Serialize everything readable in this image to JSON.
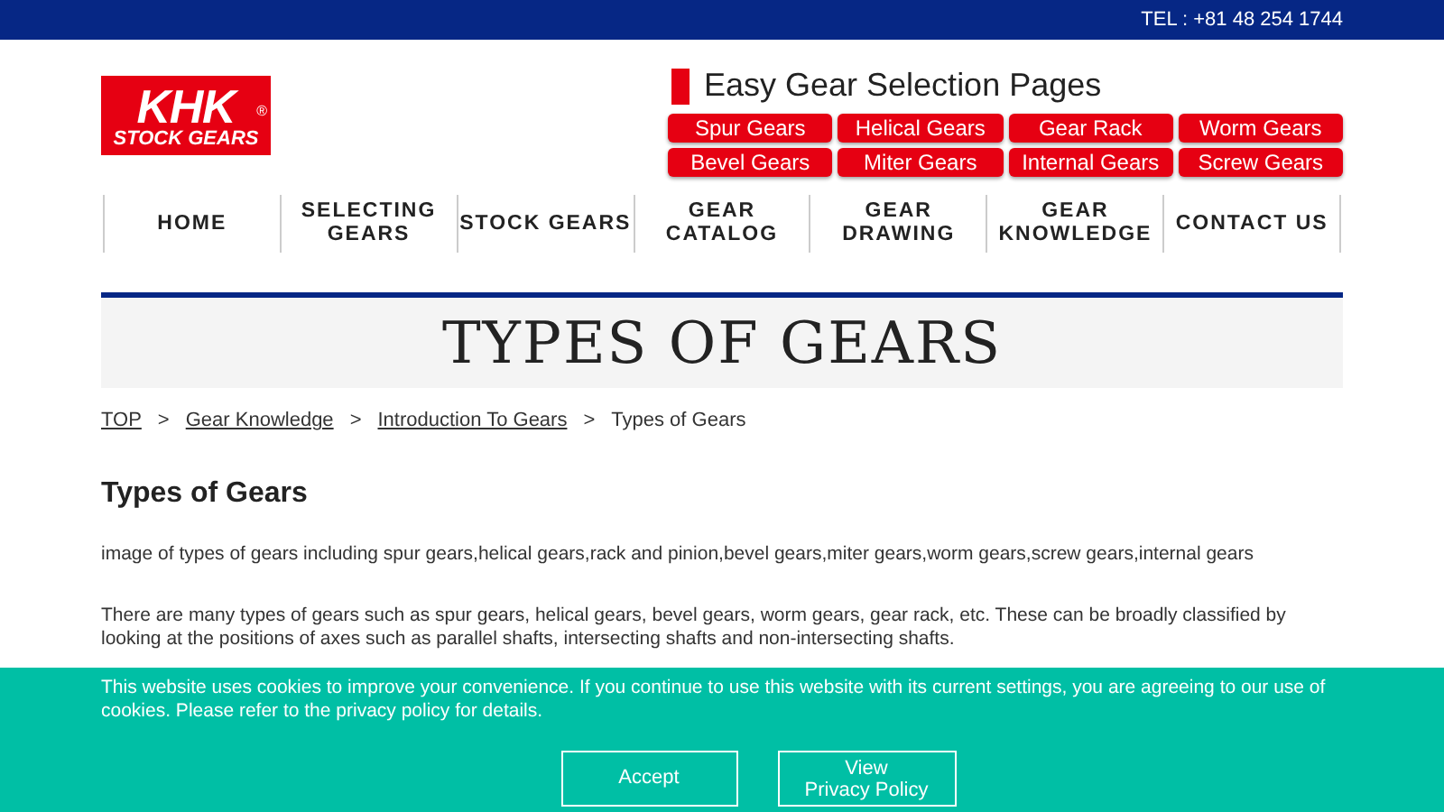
{
  "top_bar": {
    "phone": "TEL : +81 48 254 1744"
  },
  "logo": {
    "line_1": "KHK",
    "line_2": "STOCK GEARS",
    "mark": "®"
  },
  "gear_selection": {
    "title": "Easy Gear Selection Pages",
    "buttons": [
      "Spur Gears",
      "Helical Gears",
      "Gear Rack",
      "Worm Gears",
      "Bevel Gears",
      "Miter Gears",
      "Internal Gears",
      "Screw Gears"
    ]
  },
  "nav": [
    "HOME",
    "SELECTING GEARS",
    "STOCK GEARS",
    "GEAR CATALOG",
    "GEAR DRAWING",
    "GEAR KNOWLEDGE",
    "CONTACT US"
  ],
  "page_title": "TYPES OF GEARS",
  "breadcrumb": {
    "links": [
      "TOP",
      "Gear Knowledge",
      "Introduction To Gears"
    ],
    "separator": ">",
    "current": "Types of Gears"
  },
  "content": {
    "heading": "Types of Gears",
    "image_alt": "image of types of gears including spur gears,helical gears,rack and pinion,bevel gears,miter gears,worm gears,screw gears,internal gears",
    "paragraphs": [
      "There are many types of gears such as spur gears, helical gears, bevel gears, worm gears, gear rack, etc. These can be broadly classified by looking at the positions of axes such as parallel shafts, intersecting shafts and non-intersecting shafts."
    ]
  },
  "cookie_banner": {
    "message": "This website uses cookies to improve your convenience. If you continue to use this website with its current settings, you are agreeing to our use of cookies. Please refer to the privacy policy for details.",
    "accept": "Accept",
    "privacy": [
      "View",
      "Privacy Policy"
    ]
  }
}
